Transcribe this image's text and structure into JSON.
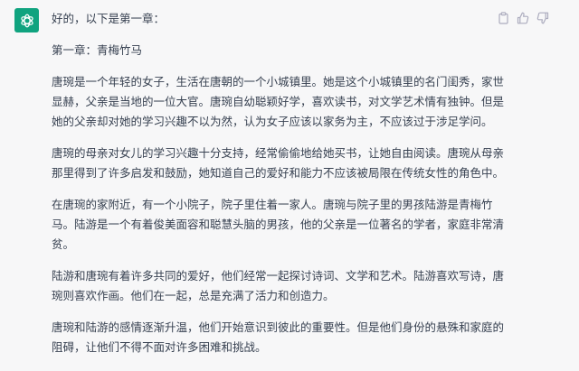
{
  "message": {
    "avatar_icon": "openai-logo-icon",
    "avatar_color": "#10a37f",
    "intro": "好的，以下是第一章：",
    "chapter_title": "第一章：青梅竹马",
    "paragraphs": [
      "唐琬是一个年轻的女子，生活在唐朝的一个小城镇里。她是这个小城镇里的名门闺秀，家世显赫，父亲是当地的一位大官。唐琬自幼聪颖好学，喜欢读书，对文学艺术情有独钟。但是她的父亲却对她的学习兴趣不以为然，认为女子应该以家务为主，不应该过于涉足学问。",
      "唐琬的母亲对女儿的学习兴趣十分支持，经常偷偷地给她买书，让她自由阅读。唐琬从母亲那里得到了许多启发和鼓励，她知道自己的爱好和能力不应该被局限在传统女性的角色中。",
      "在唐琬的家附近，有一个小院子，院子里住着一家人。唐琬与院子里的男孩陆游是青梅竹马。陆游是一个有着俊美面容和聪慧头脑的男孩，他的父亲是一位著名的学者，家庭非常清贫。",
      "陆游和唐琬有着许多共同的爱好，他们经常一起探讨诗词、文学和艺术。陆游喜欢写诗，唐琬则喜欢作画。他们在一起，总是充满了活力和创造力。",
      "唐琬和陆游的感情逐渐升温，他们开始意识到彼此的重要性。但是他们身份的悬殊和家庭的阻碍，让他们不得不面对许多困难和挑战。"
    ]
  },
  "actions": {
    "copy_icon": "clipboard-icon",
    "like_icon": "thumbs-up-icon",
    "dislike_icon": "thumbs-down-icon",
    "icon_color": "#acacbe"
  }
}
